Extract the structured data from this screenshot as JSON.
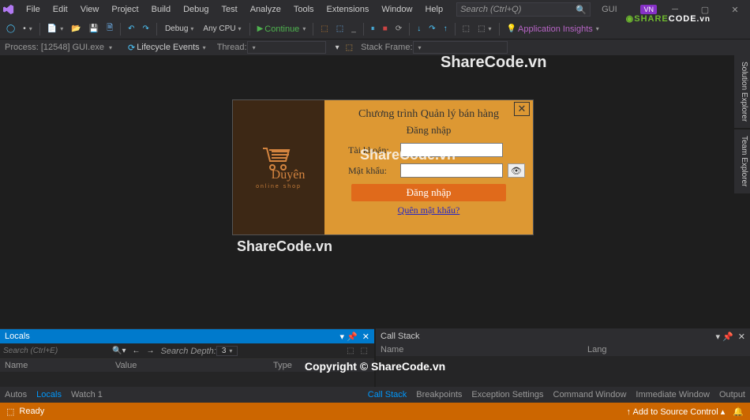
{
  "menu": [
    "File",
    "Edit",
    "View",
    "Project",
    "Build",
    "Debug",
    "Test",
    "Analyze",
    "Tools",
    "Extensions",
    "Window",
    "Help"
  ],
  "search_placeholder": "Search (Ctrl+Q)",
  "app_title": "GUI",
  "vn": "VN",
  "toolbar": {
    "config": "Debug",
    "platform": "Any CPU",
    "continue": "Continue",
    "lifecycle": "Lifecycle Events",
    "thread": "Thread:",
    "stackframe": "Stack Frame:",
    "insights": "Application Insights"
  },
  "process_line": "Process:   [12548] GUI.exe",
  "side_tabs": [
    "Solution Explorer",
    "Team Explorer"
  ],
  "login": {
    "brand_sub": "online shop",
    "title": "Chương trình Quản lý bán hàng",
    "subtitle": "Đăng nhập",
    "user_label": "Tài khoản:",
    "pass_label": "Mật khẩu:",
    "button": "Đăng nhập",
    "forgot": "Quên mật khẩu?"
  },
  "panels": {
    "locals_title": "Locals",
    "callstack_title": "Call Stack",
    "locals_search_ph": "Search (Ctrl+E)",
    "depth_ph": "Search Depth:",
    "cols": {
      "name": "Name",
      "value": "Value",
      "type": "Type",
      "lang": "Lang"
    },
    "left_tabs": [
      "Autos",
      "Locals",
      "Watch 1"
    ],
    "right_tabs": [
      "Call Stack",
      "Breakpoints",
      "Exception Settings",
      "Command Window",
      "Immediate Window",
      "Output"
    ],
    "s3": "3"
  },
  "status": {
    "ready": "Ready",
    "source": "Add to Source Control"
  },
  "wm": {
    "t1": "ShareCode.vn",
    "t2": "ShareCode.vn",
    "t3": "ShareCode.vn",
    "cp": "Copyright © ShareCode.vn"
  },
  "logo": {
    "a": "SHARE",
    "b": "CODE",
    "c": ".vn"
  }
}
